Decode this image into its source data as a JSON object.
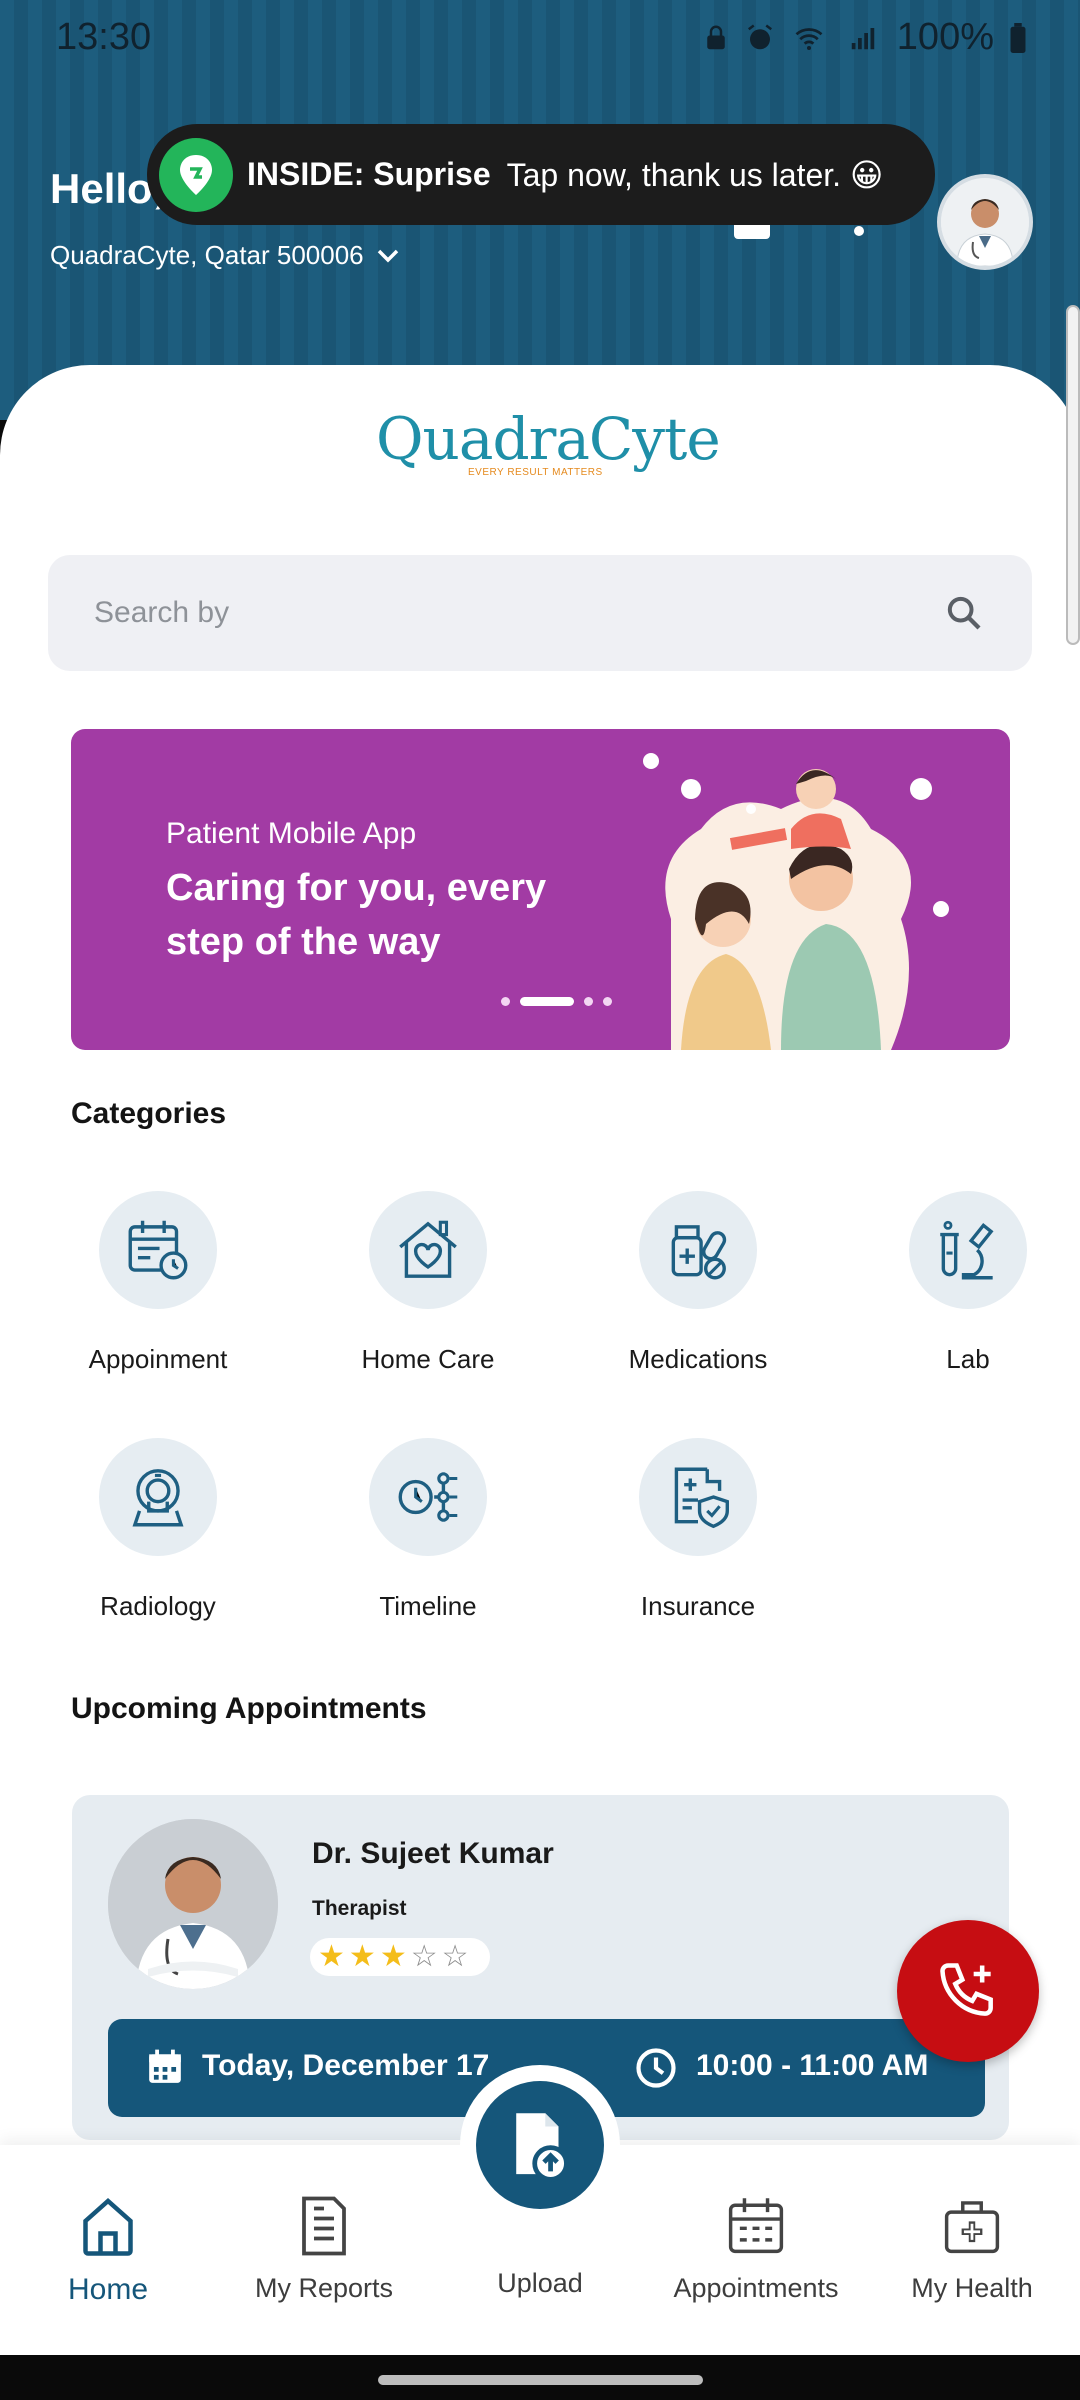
{
  "status_bar": {
    "time": "13:30",
    "battery": "100%"
  },
  "header": {
    "greeting": "Hello,",
    "location": "QuadraCyte, Qatar 500006"
  },
  "toast": {
    "title": "INSIDE: Suprise",
    "message": "Tap now, thank us later. 😀"
  },
  "logo": {
    "name": "QuadraCyte",
    "tagline": "EVERY RESULT MATTERS"
  },
  "search": {
    "placeholder": "Search by"
  },
  "banner": {
    "subtitle": "Patient Mobile App",
    "title": "Caring for you, every step of the way",
    "slides": 4,
    "active_slide": 2
  },
  "categories": {
    "title": "Categories",
    "items": [
      {
        "label": "Appoinment",
        "icon": "calendar-clock-icon"
      },
      {
        "label": "Home Care",
        "icon": "house-heart-icon"
      },
      {
        "label": "Medications",
        "icon": "medicine-bottle-icon"
      },
      {
        "label": "Lab",
        "icon": "microscope-icon"
      },
      {
        "label": "Radiology",
        "icon": "mri-scanner-icon"
      },
      {
        "label": "Timeline",
        "icon": "timeline-icon"
      },
      {
        "label": "Insurance",
        "icon": "insurance-shield-icon"
      }
    ]
  },
  "appointments": {
    "title": "Upcoming Appointments",
    "items": [
      {
        "doctor": "Dr. Sujeet Kumar",
        "role": "Therapist",
        "rating": 3,
        "rating_max": 5,
        "date": "Today, December 17",
        "time": "10:00 - 11:00 AM"
      }
    ]
  },
  "bottom_nav": {
    "items": [
      {
        "label": "Home",
        "icon": "home-icon",
        "active": true
      },
      {
        "label": "My Reports",
        "icon": "report-icon",
        "active": false
      },
      {
        "label": "Upload",
        "icon": "upload-file-icon",
        "active": false
      },
      {
        "label": "Appointments",
        "icon": "calendar-icon",
        "active": false
      },
      {
        "label": "My Health",
        "icon": "medical-bag-icon",
        "active": false
      }
    ]
  },
  "colors": {
    "primary": "#15567a",
    "header": "#1d5d7e",
    "banner": "#a23ba4",
    "fab": "#c60d12",
    "toast_badge": "#23b55a",
    "star": "#f4bd1a"
  }
}
